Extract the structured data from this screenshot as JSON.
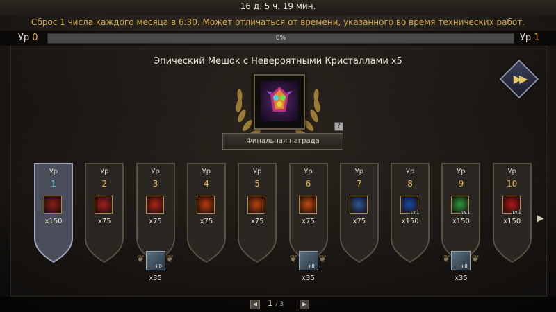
{
  "header": {
    "timer": "16 д. 5 ч. 19 мин.",
    "notice": "Сброс 1 числа каждого месяца в 6:30. Может отличаться от времени, указанного во время технических работ."
  },
  "progress": {
    "level_label": "Ур",
    "current_level": "0",
    "next_level": "1",
    "percent_text": "0%",
    "fraction": 0.0
  },
  "final_reward": {
    "title": "Эпический Мешок с Невероятными Кристаллами x5",
    "button_label": "Финальная награда",
    "help": "?"
  },
  "levels": [
    {
      "label": "Ур",
      "num": "1",
      "qty": "x150",
      "icon": "red-card-icon",
      "color": "#8a1e1a",
      "active": true
    },
    {
      "label": "Ур",
      "num": "2",
      "qty": "x75",
      "icon": "armor-scroll-icon",
      "color": "#a02020"
    },
    {
      "label": "Ур",
      "num": "3",
      "qty": "x75",
      "icon": "weapon-scroll-icon",
      "color": "#b02418"
    },
    {
      "label": "Ур",
      "num": "4",
      "qty": "x75",
      "icon": "fire-crystal-icon",
      "color": "#b83a10"
    },
    {
      "label": "Ур",
      "num": "5",
      "qty": "x75",
      "icon": "fire-crystal-icon",
      "color": "#b84410"
    },
    {
      "label": "Ур",
      "num": "6",
      "qty": "x75",
      "icon": "fire-crystal-icon",
      "color": "#c04a10"
    },
    {
      "label": "Ур",
      "num": "7",
      "qty": "x75",
      "icon": "blue-gem-icon",
      "color": "#2a5a9a"
    },
    {
      "label": "Ур",
      "num": "8",
      "qty": "x150",
      "icon": "blue-orb-icon",
      "color": "#1a4aa8",
      "tag": "Lv.1"
    },
    {
      "label": "Ур",
      "num": "9",
      "qty": "x150",
      "icon": "green-orb-icon",
      "color": "#2a9a3a",
      "tag": "Lv.1"
    },
    {
      "label": "Ур",
      "num": "10",
      "qty": "x150",
      "icon": "red-orb-icon",
      "color": "#b01818",
      "tag": "Lv.1"
    }
  ],
  "bonuses": [
    {
      "under_level": 3,
      "qty": "x35",
      "plus": "+0",
      "icon": "armor-icon"
    },
    {
      "under_level": 6,
      "qty": "x35",
      "plus": "+0",
      "icon": "ring-icon"
    },
    {
      "under_level": 9,
      "qty": "x35",
      "plus": "+0",
      "icon": "accessory-icon"
    }
  ],
  "pager": {
    "current": "1",
    "total": "/ 3"
  }
}
